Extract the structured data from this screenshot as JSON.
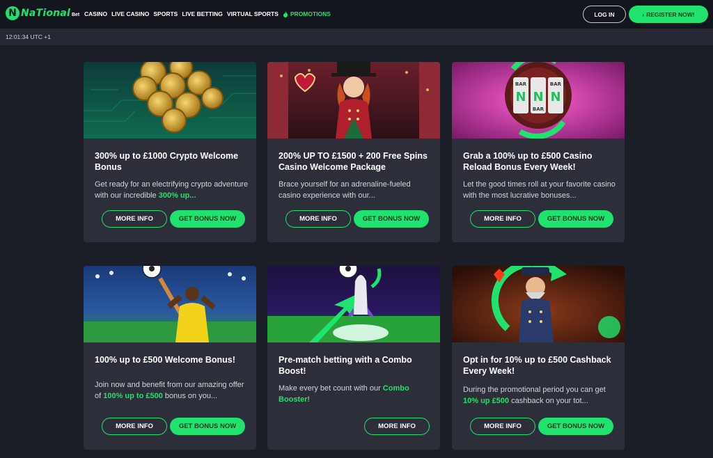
{
  "header": {
    "logo_word": "NaTional",
    "logo_bet": "Bet",
    "nav": [
      {
        "label": "CASINO"
      },
      {
        "label": "LIVE CASINO"
      },
      {
        "label": "SPORTS"
      },
      {
        "label": "LIVE BETTING"
      },
      {
        "label": "VIRTUAL SPORTS"
      },
      {
        "label": "PROMOTIONS"
      }
    ],
    "login_label": "LOG IN",
    "register_label": "REGISTER NOW!",
    "register_arrow": "›",
    "accent_color": "#20e26e"
  },
  "clock": "12:01:34 UTC +1",
  "cards": [
    {
      "title": "300% up to £1000 Crypto Welcome Bonus",
      "desc_pre": "Get ready for an electrifying crypto adventure with our incredible ",
      "desc_hl": "300% up...",
      "desc_post": "",
      "more_label": "MORE INFO",
      "bonus_label": "GET BONUS NOW"
    },
    {
      "title": "200% UP TO £1500 + 200 Free Spins Casino Welcome Package",
      "desc_pre": "Brace yourself for an adrenaline-fueled casino experience with our...",
      "desc_hl": "",
      "desc_post": "",
      "more_label": "MORE INFO",
      "bonus_label": "GET BONUS NOW"
    },
    {
      "title": "Grab a 100% up to £500 Casino Reload Bonus Every Week!",
      "desc_pre": "Let the good times roll at your favorite casino with the most lucrative bonuses...",
      "desc_hl": "",
      "desc_post": "",
      "more_label": "MORE INFO",
      "bonus_label": "GET BONUS NOW"
    },
    {
      "title": "100% up to £500 Welcome Bonus!",
      "desc_pre": "Join now and benefit from our amazing offer of ",
      "desc_hl": "100% up to £500",
      "desc_post": " bonus on you...",
      "more_label": "MORE INFO",
      "bonus_label": "GET BONUS NOW"
    },
    {
      "title": "Pre-match betting with a Combo Boost!",
      "desc_pre": "Make every bet count with our ",
      "desc_hl": "Combo Booster",
      "desc_post": "!",
      "more_label": "MORE INFO",
      "bonus_label": ""
    },
    {
      "title": "Opt in for 10% up to £500 Cashback Every Week!",
      "desc_pre": "During the promotional period you can get ",
      "desc_hl": "10% up £500",
      "desc_post": " cashback on your tot...",
      "more_label": "MORE INFO",
      "bonus_label": "GET BONUS NOW"
    }
  ],
  "reel_symbols": [
    "N",
    "N",
    "N",
    "BAR",
    "BAR",
    "BAR"
  ]
}
